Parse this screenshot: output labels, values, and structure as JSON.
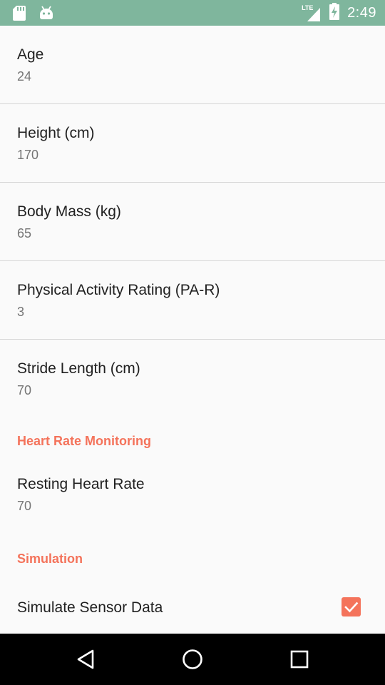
{
  "status_bar": {
    "time": "2:49",
    "network": "LTE",
    "left_icons": [
      "sd-card-icon",
      "android-icon"
    ],
    "right_icons": [
      "signal-icon",
      "battery-charging-icon"
    ]
  },
  "preferences": [
    {
      "title": "Age",
      "value": "24"
    },
    {
      "title": "Height (cm)",
      "value": "170"
    },
    {
      "title": "Body Mass (kg)",
      "value": "65"
    },
    {
      "title": "Physical Activity Rating (PA-R)",
      "value": "3"
    },
    {
      "title": "Stride Length (cm)",
      "value": "70"
    }
  ],
  "heart_rate_section": {
    "label": "Heart Rate Monitoring",
    "items": [
      {
        "title": "Resting Heart Rate",
        "value": "70"
      }
    ]
  },
  "simulation_section": {
    "label": "Simulation",
    "items": [
      {
        "title": "Simulate Sensor Data",
        "checked": true
      }
    ]
  },
  "nav_bar": {
    "buttons": [
      "back-icon",
      "home-icon",
      "recents-icon"
    ]
  },
  "colors": {
    "status_bar": "#7fb69d",
    "accent": "#f4735b",
    "background": "#fafafa",
    "nav_bar": "#000000"
  }
}
